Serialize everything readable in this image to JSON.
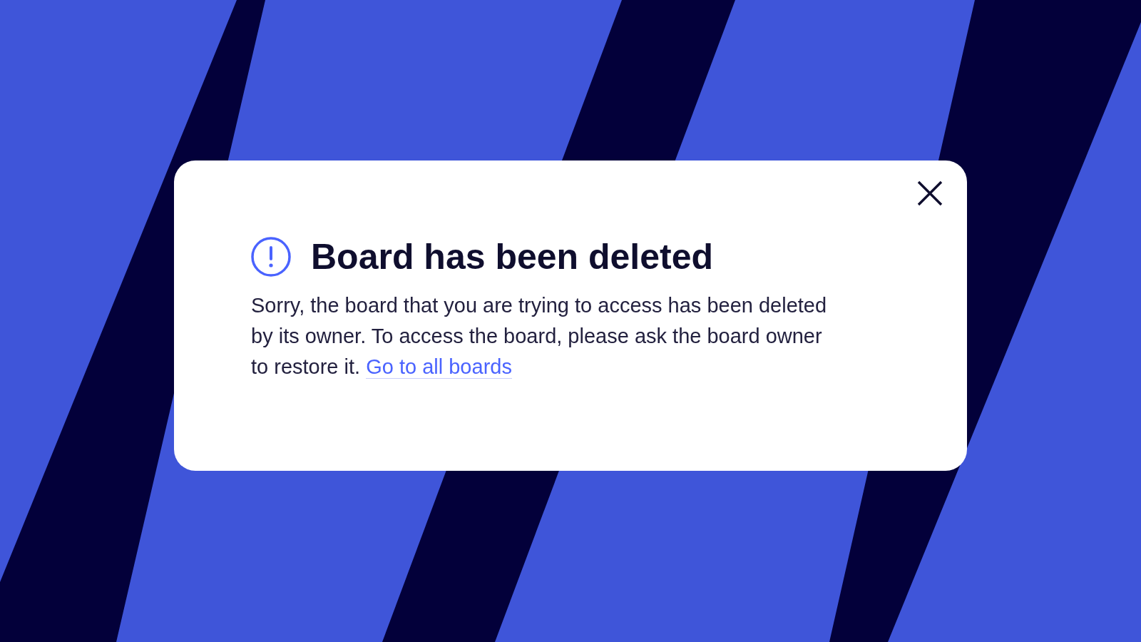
{
  "dialog": {
    "title": "Board has been deleted",
    "message": "Sorry, the board that you are trying to access has been deleted by its owner. To access the board, please ask the board owner to restore it.",
    "link": "Go to all boards"
  }
}
